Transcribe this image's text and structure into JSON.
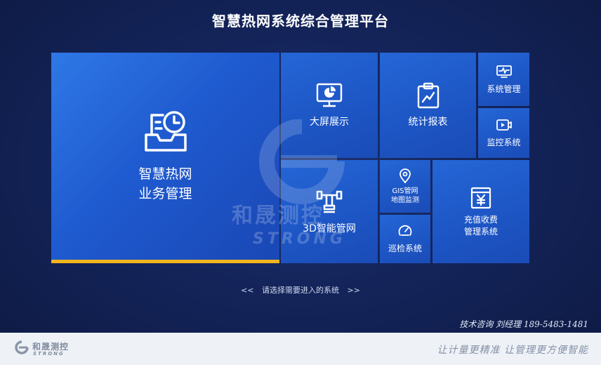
{
  "header": {
    "title": "智慧热网系统综合管理平台"
  },
  "tiles": {
    "business": {
      "line1": "智慧热网",
      "line2": "业务管理",
      "icon": "inbox-clock-icon"
    },
    "big_screen": {
      "label": "大屏展示",
      "icon": "monitor-pie-chart-icon"
    },
    "statistics": {
      "label": "统计报表",
      "icon": "clipboard-chart-icon"
    },
    "system_mgmt": {
      "label": "系统管理",
      "icon": "monitor-pulse-icon"
    },
    "monitoring": {
      "label": "监控系统",
      "icon": "video-camera-icon"
    },
    "pipe_3d": {
      "label": "3D智能管网",
      "icon": "pipe-valve-icon"
    },
    "gis": {
      "line1": "GIS管网",
      "line2": "地图监测",
      "icon": "map-pin-icon"
    },
    "inspection": {
      "label": "巡检系统",
      "icon": "gauge-icon"
    },
    "billing": {
      "line1": "充值收费",
      "line2": "管理系统",
      "icon": "yuan-receipt-icon"
    }
  },
  "hint": {
    "left": "<<",
    "text": "请选择需要进入的系统",
    "right": ">>"
  },
  "contact": "技术咨询 刘经理 189-5483-1481",
  "watermark": {
    "text_cn": "和晟测控",
    "text_en": "STRONG"
  },
  "footer": {
    "logo_cn": "和晟测控",
    "logo_en": "STRONG",
    "slogan": "让计量更精准 让管理更方便智能"
  },
  "colors": {
    "accent": "#f2b51f",
    "tile_blue": "#1f5bd0",
    "background": "#14245a"
  }
}
